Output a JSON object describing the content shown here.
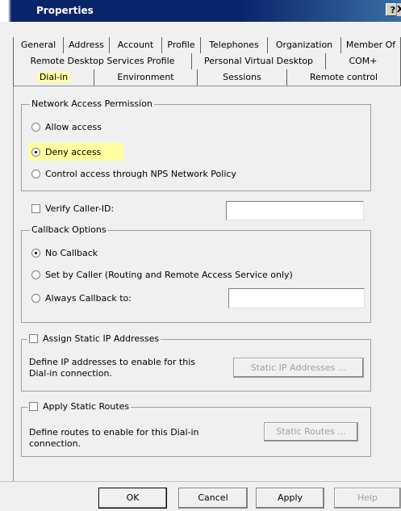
{
  "window": {
    "title": "Properties",
    "help_glyph": "?",
    "close_glyph": "X"
  },
  "tabs": {
    "row1": [
      "General",
      "Address",
      "Account",
      "Profile",
      "Telephones",
      "Organization",
      "Member Of"
    ],
    "row2": [
      "Remote Desktop Services Profile",
      "Personal Virtual Desktop",
      "COM+"
    ],
    "row3": [
      "Dial-in",
      "Environment",
      "Sessions",
      "Remote control"
    ],
    "active": "Dial-in"
  },
  "network_access": {
    "legend": "Network Access Permission",
    "allow": "Allow access",
    "deny": "Deny access",
    "nps": "Control access through NPS Network Policy",
    "selected": "deny"
  },
  "verify": {
    "label": "Verify Caller-ID:",
    "value": ""
  },
  "callback": {
    "legend": "Callback Options",
    "none": "No Callback",
    "by_caller": "Set by Caller (Routing and Remote Access Service only)",
    "always": "Always Callback to:",
    "selected": "none",
    "value": ""
  },
  "static_ip": {
    "label": "Assign Static IP Addresses",
    "desc1": "Define IP addresses to enable for this",
    "desc2": "Dial-in connection.",
    "button": "Static IP Addresses ..."
  },
  "static_routes": {
    "label": "Apply Static Routes",
    "desc1": "Define routes to enable for this Dial-in",
    "desc2": "connection.",
    "button": "Static Routes ..."
  },
  "buttons": {
    "ok": "OK",
    "cancel": "Cancel",
    "apply": "Apply",
    "help": "Help"
  }
}
